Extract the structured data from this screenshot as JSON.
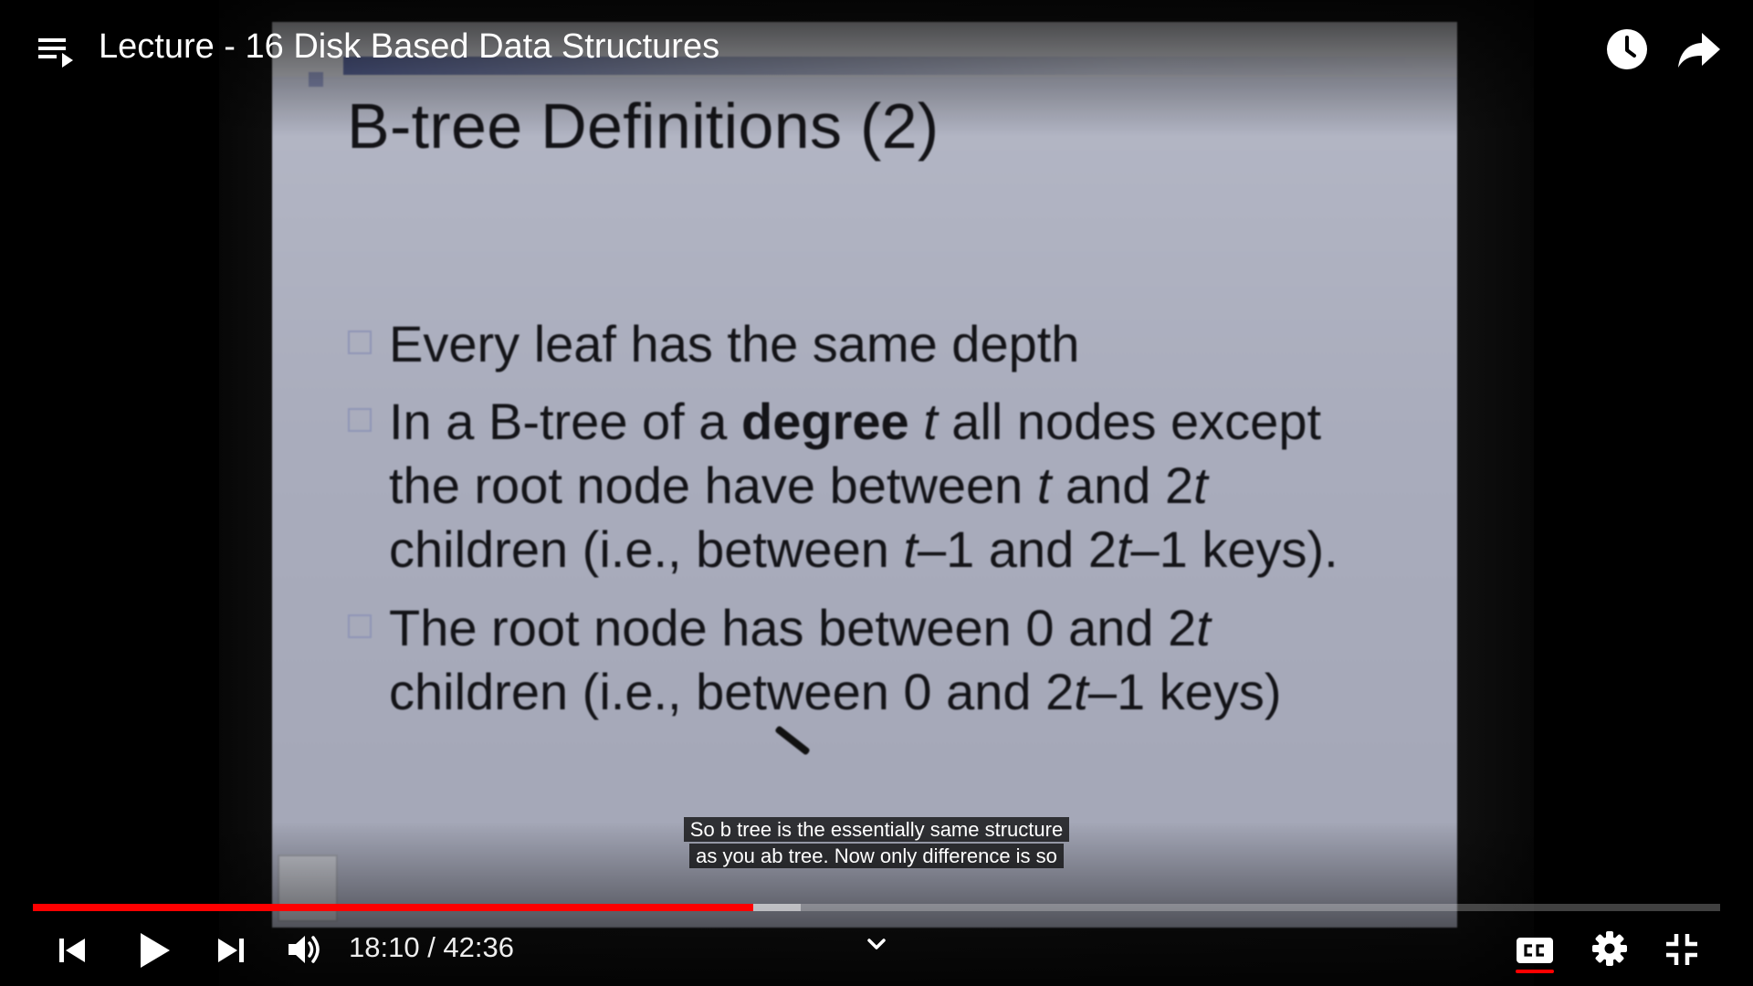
{
  "video": {
    "title": "Lecture - 16 Disk Based Data Structures"
  },
  "slide": {
    "title": "B-tree Definitions (2)",
    "bullets": [
      {
        "lines": [
          "Every leaf has the same depth"
        ]
      },
      {
        "line1_pre": "In a B-tree of a ",
        "line1_bold": "degree",
        "line1_space": " ",
        "line1_it": "t",
        "line1_post": " all nodes except",
        "line2_pre": "the root node have between ",
        "line2_it1": "t",
        "line2_mid": " and 2",
        "line2_it2": "t",
        "line3_pre": "children (i.e., between ",
        "line3_it1": "t",
        "line3_mid": "–1 and 2",
        "line3_it2": "t",
        "line3_post": "–1 keys)."
      },
      {
        "line1_pre": "The root node has between 0 and 2",
        "line1_it": "t",
        "line2_pre": "children (i.e., between 0 and 2",
        "line2_it": "t",
        "line2_post": "–1 keys)"
      }
    ]
  },
  "captions": {
    "line1": "So b tree is the essentially same structure",
    "line2": "as you ab tree. Now only difference is so"
  },
  "player": {
    "current_time": "18:10",
    "duration": "42:36",
    "time_text": "18:10 / 42:36",
    "progress_played_fraction": 0.4267,
    "progress_buffered_fraction": 0.4553,
    "accent_color": "#ff0000",
    "captions_enabled": true,
    "icons": [
      "playlist-icon",
      "watch-later-icon",
      "share-icon",
      "previous-icon",
      "play-icon",
      "next-icon",
      "volume-icon",
      "chevron-down-icon",
      "closed-captions-icon",
      "settings-icon",
      "exit-fullscreen-icon"
    ]
  }
}
